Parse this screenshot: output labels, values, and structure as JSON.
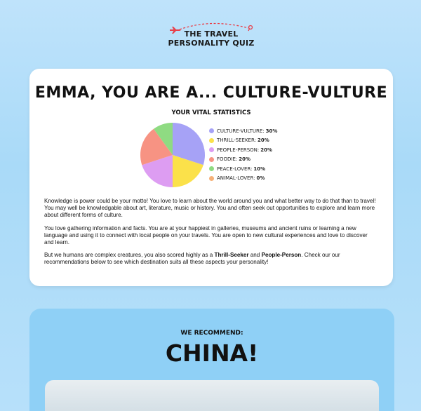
{
  "logo": {
    "line1": "THE TRAVEL",
    "line2": "PERSONALITY QUIZ"
  },
  "result": {
    "title": "EMMA, YOU ARE A... CULTURE-VULTURE",
    "stats_heading": "YOUR VITAL STATISTICS"
  },
  "chart_data": {
    "type": "pie",
    "title": "YOUR VITAL STATISTICS",
    "slices": [
      {
        "label": "CULTURE-VULTURE:",
        "value": 30,
        "display": "30%",
        "color": "#a6a2f6"
      },
      {
        "label": "THRILL-SEEKER:",
        "value": 20,
        "display": "20%",
        "color": "#fbe14a"
      },
      {
        "label": "PEOPLE-PERSON:",
        "value": 20,
        "display": "20%",
        "color": "#dd9df2"
      },
      {
        "label": "FOODIE:",
        "value": 20,
        "display": "20%",
        "color": "#f79383"
      },
      {
        "label": "PEACE-LOVER:",
        "value": 10,
        "display": "10%",
        "color": "#8fdb82"
      },
      {
        "label": "ANIMAL-LOVER:",
        "value": 0,
        "display": "0%",
        "color": "#f6b179"
      }
    ],
    "legend": "right"
  },
  "body": {
    "p1": "Knowledge is power could be your motto! You love to learn about the world around you and what better way to do that than to travel! You may well be knowledgable about art, literature, music or history. You and often seek out opportunities to explore and learn more about different forms of culture.",
    "p2": "You love gathering information and facts. You are at your happiest in galleries, museums and ancient ruins or learning a new language and using it to connect with local people on your travels. You are open to new cultural experiences and love to discover and learn.",
    "p3_start": "But we humans are complex creatures, you also scored highly as a ",
    "p3_type1": "Thrill-Seeker",
    "p3_and": " and ",
    "p3_type2": "People-Person",
    "p3_end": ". Check our our recommendations below to see which destination suits all these aspects your personality!"
  },
  "recommendation": {
    "label": "WE RECOMMEND:",
    "country": "CHINA!"
  },
  "colors": {
    "background": "#b7e0fa",
    "recommend_panel": "#8fd0f6",
    "logo_accent": "#e8404a"
  }
}
